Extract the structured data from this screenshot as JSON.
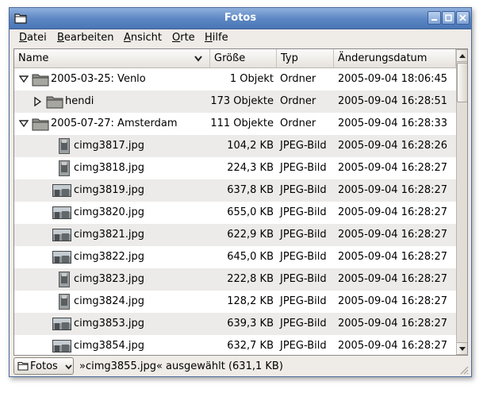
{
  "window": {
    "title": "Fotos"
  },
  "menu": [
    {
      "accel": "D",
      "rest": "atei"
    },
    {
      "accel": "B",
      "rest": "earbeiten"
    },
    {
      "accel": "A",
      "rest": "nsicht"
    },
    {
      "accel": "O",
      "rest": "rte"
    },
    {
      "accel": "H",
      "rest": "ilfe"
    }
  ],
  "columns": {
    "name": "Name",
    "size": "Größe",
    "type": "Typ",
    "date": "Änderungsdatum"
  },
  "rows": [
    {
      "name": "2005-03-25: Venlo",
      "size": "1 Objekt",
      "type": "Ordner",
      "date": "2005-09-04 18:06:45",
      "level": 0,
      "expander": "expanded",
      "icon": "folder-icon"
    },
    {
      "name": "hendi",
      "size": "173 Objekte",
      "type": "Ordner",
      "date": "2005-09-04 16:28:51",
      "level": 1,
      "expander": "collapsed",
      "icon": "folder-icon"
    },
    {
      "name": "2005-07-27: Amsterdam",
      "size": "111 Objekte",
      "type": "Ordner",
      "date": "2005-09-04 16:28:33",
      "level": 0,
      "expander": "expanded",
      "icon": "folder-icon"
    },
    {
      "name": "cimg3817.jpg",
      "size": "104,2 KB",
      "type": "JPEG-Bild",
      "date": "2005-09-04 16:28:26",
      "level": 1,
      "icon": "thumbnail-portrait"
    },
    {
      "name": "cimg3818.jpg",
      "size": "224,3 KB",
      "type": "JPEG-Bild",
      "date": "2005-09-04 16:28:27",
      "level": 1,
      "icon": "thumbnail-portrait"
    },
    {
      "name": "cimg3819.jpg",
      "size": "637,8 KB",
      "type": "JPEG-Bild",
      "date": "2005-09-04 16:28:27",
      "level": 1,
      "icon": "thumbnail-landscape"
    },
    {
      "name": "cimg3820.jpg",
      "size": "655,0 KB",
      "type": "JPEG-Bild",
      "date": "2005-09-04 16:28:27",
      "level": 1,
      "icon": "thumbnail-landscape"
    },
    {
      "name": "cimg3821.jpg",
      "size": "622,9 KB",
      "type": "JPEG-Bild",
      "date": "2005-09-04 16:28:27",
      "level": 1,
      "icon": "thumbnail-landscape"
    },
    {
      "name": "cimg3822.jpg",
      "size": "645,0 KB",
      "type": "JPEG-Bild",
      "date": "2005-09-04 16:28:27",
      "level": 1,
      "icon": "thumbnail-landscape"
    },
    {
      "name": "cimg3823.jpg",
      "size": "222,8 KB",
      "type": "JPEG-Bild",
      "date": "2005-09-04 16:28:27",
      "level": 1,
      "icon": "thumbnail-portrait"
    },
    {
      "name": "cimg3824.jpg",
      "size": "128,2 KB",
      "type": "JPEG-Bild",
      "date": "2005-09-04 16:28:27",
      "level": 1,
      "icon": "thumbnail-portrait"
    },
    {
      "name": "cimg3853.jpg",
      "size": "639,3 KB",
      "type": "JPEG-Bild",
      "date": "2005-09-04 16:28:27",
      "level": 1,
      "icon": "thumbnail-landscape"
    },
    {
      "name": "cimg3854.jpg",
      "size": "632,7 KB",
      "type": "JPEG-Bild",
      "date": "2005-09-04 16:28:27",
      "level": 1,
      "icon": "thumbnail-landscape"
    }
  ],
  "statusbar": {
    "location": "Fotos",
    "text": "»cimg3855.jpg« ausgewählt (631,1 KB)"
  },
  "colors": {
    "titlebar": "#5b86c3",
    "row_alt": "#ecebe9",
    "folder": "#8a8a86"
  }
}
